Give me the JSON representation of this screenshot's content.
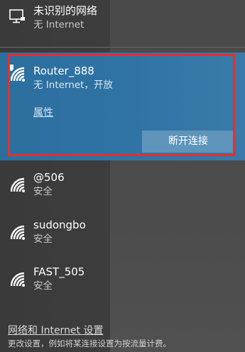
{
  "wired": {
    "name": "未识别的网络",
    "status": "无 Internet"
  },
  "selected_network": {
    "ssid": "Router_888",
    "status": "无 Internet，开放",
    "properties_label": "属性",
    "disconnect_label": "断开连接"
  },
  "networks": [
    {
      "ssid": "@506",
      "status": "安全"
    },
    {
      "ssid": "sudongbo",
      "status": "安全"
    },
    {
      "ssid": "FAST_505",
      "status": "安全"
    }
  ],
  "footer": {
    "settings_link": "网络和 Internet 设置",
    "description": "更改设置，例如将某连接设置为按流量计费。"
  },
  "icons": {
    "wired": "ethernet-monitor-icon",
    "wifi_open": "wifi-warning-icon",
    "wifi": "wifi-icon"
  },
  "colors": {
    "selected_bg": "#2f73a4",
    "highlight_border": "#e2302c",
    "disconnect_bg": "#5f95bb"
  }
}
